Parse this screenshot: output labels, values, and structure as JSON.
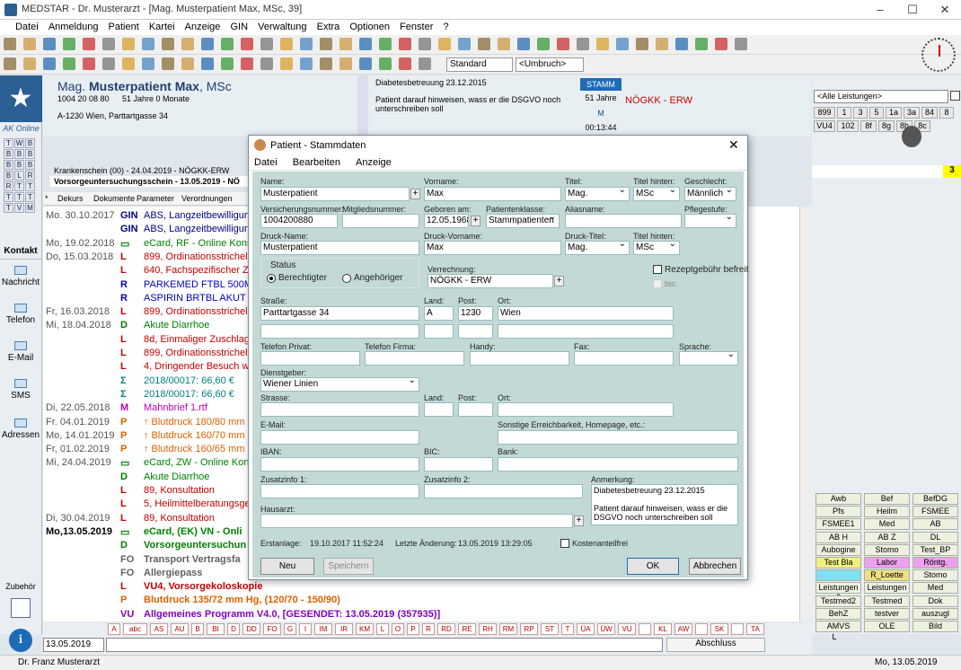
{
  "app": {
    "title": "MEDSTAR - Dr. Musterarzt - [Mag. Musterpatient Max, MSc, 39]"
  },
  "menu": [
    "Datei",
    "Anmeldung",
    "Patient",
    "Kartei",
    "Anzeige",
    "GIN",
    "Verwaltung",
    "Extra",
    "Optionen",
    "Fenster",
    "?"
  ],
  "toolbar": {
    "standard": "Standard",
    "umbruch": "<Umbruch>"
  },
  "left": {
    "ak_online": "AK Online",
    "grid": [
      "T",
      "W",
      "B",
      "B",
      "B",
      "B",
      "B",
      "B",
      "B",
      "B",
      "L",
      "R",
      "R",
      "T",
      "T",
      "T",
      "T",
      "T",
      "T",
      "V",
      "M"
    ],
    "kontakt": "Kontakt",
    "items": [
      "Nachricht",
      "Telefon",
      "E-Mail",
      "SMS",
      "Adressen"
    ],
    "zubehoer": "Zubehör"
  },
  "patient": {
    "name_prefix": "Mag. ",
    "name_bold": "Musterpatient Max",
    "name_suffix": ", MSc",
    "id": "1004 20 08 80",
    "age": "51 Jahre 0 Monate",
    "address": "A-1230 Wien, Parttartgasse 34",
    "note_title": "Diabetesbetreuung 23.12.2015",
    "note_text": "Patient darauf hinweisen, wass er die DSGVO noch unterschreiben soll",
    "stamm": "STAMM",
    "jahre": "51 Jahre",
    "sex": "M",
    "time": "00:13:44",
    "kasse": "NÖGKK - ERW"
  },
  "krankenschein": {
    "line1": "Krankenschein (00) - 24.04.2019 - NÖGKK-ERW",
    "line2": "Vorsorgeuntersuchungsschein - 13.05.2019 - NÖ"
  },
  "tabs": [
    "*",
    "Dekurs",
    "Dokumente",
    "Parameter",
    "Verordnungen"
  ],
  "entries": [
    {
      "d": "Mo. 30.10.2017",
      "c": "GIN",
      "t": "ABS, Langzeitbewilligung",
      "col": "#000080"
    },
    {
      "d": "",
      "c": "GIN",
      "t": "ABS, Langzeitbewilligung",
      "col": "#000080"
    },
    {
      "d": "Mo, 19.02.2018",
      "c": "▭",
      "t": "eCard, RF - Online Konsu",
      "col": "#008000"
    },
    {
      "d": "Do, 15.03.2018",
      "c": "L",
      "t": "899, Ordinationsstrichel",
      "col": "#c00000"
    },
    {
      "d": "",
      "c": "L",
      "t": "640, Fachspezifischer Zu",
      "col": "#c00000"
    },
    {
      "d": "",
      "c": "R",
      "t": "PARKEMED FTBL 500M",
      "col": "#0000c0"
    },
    {
      "d": "",
      "c": "R",
      "t": "ASPIRIN BRTBL AKUT 1",
      "col": "#0000c0"
    },
    {
      "d": "Fr,  16.03.2018",
      "c": "L",
      "t": "899, Ordinationsstrichel",
      "col": "#c00000"
    },
    {
      "d": "Mi,  18.04.2018",
      "c": "D",
      "t": "Akute Diarrhoe",
      "col": "#008000"
    },
    {
      "d": "",
      "c": "L",
      "t": "8d, Einmaliger Zuschlag",
      "col": "#c00000"
    },
    {
      "d": "",
      "c": "L",
      "t": "899, Ordinationsstrichel",
      "col": "#c00000"
    },
    {
      "d": "",
      "c": "L",
      "t": "4, Dringender Besuch wä",
      "col": "#c00000"
    },
    {
      "d": "",
      "c": "Σ",
      "t": "2018/00017: 66,60 €",
      "col": "#008080"
    },
    {
      "d": "",
      "c": "Σ",
      "t": "2018/00017: 66,60 €",
      "col": "#008080"
    },
    {
      "d": "Di,  22.05.2018",
      "c": "M",
      "t": "Mahnbrief 1.rtf",
      "col": "#c000c0"
    },
    {
      "d": "Fr.  04.01.2019",
      "c": "P",
      "t": "↑ Blutdruck 180/80 mm H",
      "col": "#e06000"
    },
    {
      "d": "Mo, 14.01.2019",
      "c": "P",
      "t": "↑ Blutdruck 160/70 mm H",
      "col": "#e06000"
    },
    {
      "d": "Fr,  01.02.2019",
      "c": "P",
      "t": "↑ Blutdruck 160/65 mm",
      "col": "#e06000"
    },
    {
      "d": "Mi,  24.04.2019",
      "c": "▭",
      "t": "eCard, ZW - Online Konsu",
      "col": "#008000"
    },
    {
      "d": "",
      "c": "D",
      "t": "Akute Diarrhoe",
      "col": "#008000"
    },
    {
      "d": "",
      "c": "L",
      "t": "89, Konsultation",
      "col": "#c00000"
    },
    {
      "d": "",
      "c": "L",
      "t": "5, Heilmittelberatungsges",
      "col": "#c00000"
    },
    {
      "d": "Di,  30.04.2019",
      "c": "L",
      "t": "89, Konsultation",
      "col": "#c00000"
    },
    {
      "d": "Mo,13.05.2019",
      "c": "▭",
      "t": "eCard, (EK) VN - Onli",
      "col": "#008000"
    },
    {
      "d": "",
      "c": "D",
      "t": "Vorsorgeuntersuchun",
      "col": "#008000"
    },
    {
      "d": "",
      "c": "FO",
      "t": "Transport Vertragsfa",
      "col": "#606060"
    },
    {
      "d": "",
      "c": "FO",
      "t": "Allergiepass",
      "col": "#606060"
    },
    {
      "d": "",
      "c": "L",
      "t": "VU4, Vorsorgekoloskopie",
      "col": "#c00000"
    },
    {
      "d": "",
      "c": "P",
      "t": "Blutdruck 135/72 mm Hg, (120/70 - 150/90)",
      "col": "#e06000"
    },
    {
      "d": "",
      "c": "VU",
      "t": "Allgemeines Programm V4.0, [GESENDET: 13.05.2019 (357935)]",
      "col": "#8000c0"
    }
  ],
  "right": {
    "filter": "<Alle Leistungen>",
    "codes1": [
      "899",
      "1",
      "3",
      "5",
      "1a",
      "3a",
      "84",
      "8"
    ],
    "codes2": [
      "VU4",
      "102",
      "8f",
      "8g",
      "8h",
      "8c"
    ],
    "count": "3",
    "grid": [
      "Awb",
      "Bef",
      "BefDG",
      "Pfs",
      "Heilm",
      "FSMEE",
      "FSMEE1",
      "Med",
      "AB",
      "AB H",
      "AB Z",
      "DL",
      "Aubogine",
      "Stomo",
      "Test_BP",
      "Test Bla",
      "Labor",
      "Röntg.",
      "",
      "R_Loette",
      "Stomo",
      "Leistungen 2",
      "Leistungen",
      "Med",
      "Testmed2",
      "Testmed",
      "Dok",
      "BehZ",
      "testver",
      "auszugl",
      "AMVS",
      "OLE",
      "Bild"
    ],
    "l": "L"
  },
  "bottom": {
    "keys": [
      "A",
      "abc",
      "AS",
      "AU",
      "B",
      "BI",
      "D",
      "DD",
      "FO",
      "G",
      "I",
      "IM",
      "IR",
      "KM",
      "L",
      "O",
      "P",
      "R",
      "RD",
      "RE",
      "RH",
      "RM",
      "RP",
      "ST",
      "T",
      "ÜA",
      "ÜW",
      "VU",
      "",
      "KL",
      "AW",
      "",
      "SK",
      "",
      "TA"
    ],
    "date": "13.05.2019",
    "abschluss": "Abschluss"
  },
  "status": {
    "doctor": "Dr. Franz Musterarzt",
    "date": "Mo, 13.05.2019"
  },
  "dialog": {
    "title": "Patient - Stammdaten",
    "menu": [
      "Datei",
      "Bearbeiten",
      "Anzeige"
    ],
    "labels": {
      "name": "Name:",
      "vorname": "Vorname:",
      "titel": "Titel:",
      "titel_hinten": "Titel hinten:",
      "geschlecht": "Geschlecht:",
      "vnr": "Versicherungsnummer:",
      "mitglied": "Mitgliedsnummer:",
      "geboren": "Geboren am:",
      "klasse": "Patientenklasse:",
      "alias": "Aliasname:",
      "pflege": "Pflegestufe:",
      "druck_name": "Druck-Name:",
      "druck_vorname": "Druck-Vorname:",
      "druck_titel": "Druck-Titel:",
      "titel_hinten2": "Titel hinten:",
      "status": "Status",
      "berechtigter": "Berechtigter",
      "angehoeriger": "Angehöriger",
      "verrechnung": "Verrechnung:",
      "rezept": "Rezeptgebühr befreit",
      "bis": "bis:",
      "strasse": "Straße:",
      "land": "Land:",
      "post": "Post:",
      "ort": "Ort:",
      "tel_privat": "Telefon Privat:",
      "tel_firma": "Telefon Firma:",
      "handy": "Handy:",
      "fax": "Fax:",
      "sprache": "Sprache:",
      "dienstgeber": "Dienstgeber:",
      "strasse2": "Strasse:",
      "land2": "Land:",
      "post2": "Post:",
      "ort2": "Ort:",
      "email": "E-Mail:",
      "sonstige": "Sonstige Erreichbarkeit, Homepage, etc.:",
      "iban": "IBAN:",
      "bic": "BIC:",
      "bank": "Bank:",
      "zusatz1": "Zusatzinfo 1:",
      "zusatz2": "Zusatzinfo 2:",
      "anmerkung": "Anmerkung:",
      "hausarzt": "Hausarzt:",
      "erstanlage": "Erstanlage:",
      "aenderung": "Letzte Änderung:",
      "kostenfrei": "Kostenanteilfrei"
    },
    "values": {
      "name": "Musterpatient",
      "vorname": "Max",
      "titel": "Mag.",
      "titel_hinten": "MSc",
      "geschlecht": "Männlich",
      "vnr": "1004200880",
      "geboren": "12.05.1968",
      "klasse": "Stammpatienten",
      "druck_name": "Musterpatient",
      "druck_vorname": "Max",
      "druck_titel": "Mag.",
      "druck_titel_hinten": "MSc",
      "verrechnung": "NÖGKK - ERW",
      "strasse": "Parttartgasse 34",
      "land": "A",
      "post": "1230",
      "ort": "Wien",
      "dienstgeber": "Wiener Linien",
      "anmerkung": "Diabetesbetreuung 23.12.2015\n\nPatient darauf hinweisen, wass er die DSGVO noch unterschreiben soll",
      "erstanlage": "19.10.2017 11:52:24",
      "aenderung": "13.05.2019 13:29:05"
    },
    "buttons": {
      "neu": "Neu",
      "speichern": "Speichern",
      "ok": "OK",
      "abbrechen": "Abbrechen"
    }
  }
}
